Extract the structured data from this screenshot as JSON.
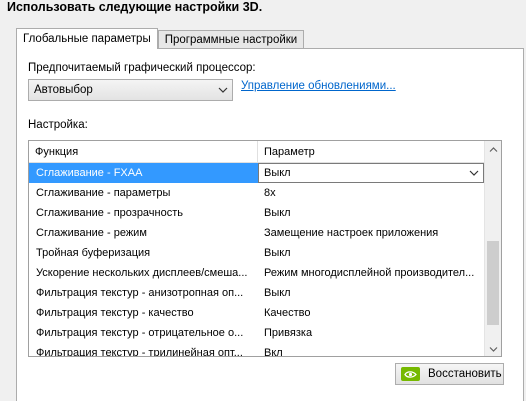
{
  "heading": "Использовать следующие настройки 3D.",
  "tabs": [
    {
      "label": "Глобальные параметры",
      "active": true
    },
    {
      "label": "Программные настройки",
      "active": false
    }
  ],
  "gpu": {
    "label": "Предпочитаемый графический процессор:",
    "selected": "Автовыбор",
    "update_link": "Управление обновлениями..."
  },
  "settings": {
    "label": "Настройка:",
    "columns": [
      "Функция",
      "Параметр"
    ],
    "rows": [
      {
        "feature": "Сглаживание - FXAA",
        "value": "Выкл"
      },
      {
        "feature": "Сглаживание - параметры",
        "value": "8x"
      },
      {
        "feature": "Сглаживание - прозрачность",
        "value": "Выкл"
      },
      {
        "feature": "Сглаживание - режим",
        "value": "Замещение настроек приложения"
      },
      {
        "feature": "Тройная буферизация",
        "value": "Выкл"
      },
      {
        "feature": "Ускорение нескольких дисплеев/смеша...",
        "value": "Режим многодисплейной производител..."
      },
      {
        "feature": "Фильтрация текстур - анизотропная оп...",
        "value": "Выкл"
      },
      {
        "feature": "Фильтрация текстур - качество",
        "value": "Качество"
      },
      {
        "feature": "Фильтрация текстур - отрицательное о...",
        "value": "Привязка"
      },
      {
        "feature": "Фильтрация текстур - трилинейная опт...",
        "value": "Вкл"
      }
    ],
    "selected_row": 0
  },
  "restore_button": "Восстановить",
  "colors": {
    "selection": "#3399ff",
    "link": "#0066cc",
    "nvidia": "#76b900"
  },
  "icons": [
    "chevron-down-icon",
    "scroll-up-icon",
    "scroll-down-icon",
    "nvidia-logo-icon"
  ]
}
